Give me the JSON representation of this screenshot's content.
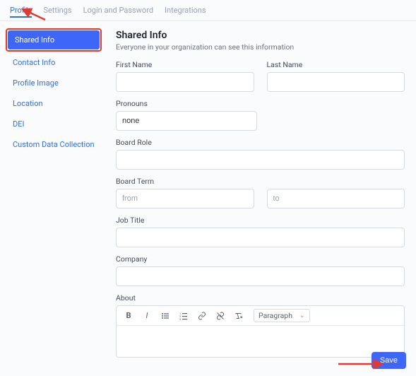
{
  "topTabs": {
    "profile": "Profile",
    "settings": "Settings",
    "login": "Login and Password",
    "integrations": "Integrations"
  },
  "sidebar": {
    "sharedInfo": "Shared Info",
    "contactInfo": "Contact Info",
    "profileImage": "Profile Image",
    "location": "Location",
    "dei": "DEI",
    "customData": "Custom Data Collection"
  },
  "section": {
    "title": "Shared Info",
    "subtitle": "Everyone in your organization can see this information"
  },
  "fields": {
    "firstName": {
      "label": "First Name",
      "value": ""
    },
    "lastName": {
      "label": "Last Name",
      "value": ""
    },
    "pronouns": {
      "label": "Pronouns",
      "value": "none"
    },
    "boardRole": {
      "label": "Board Role",
      "value": ""
    },
    "boardTerm": {
      "label": "Board Term",
      "fromPlaceholder": "from",
      "toPlaceholder": "to"
    },
    "jobTitle": {
      "label": "Job Title",
      "value": ""
    },
    "company": {
      "label": "Company",
      "value": ""
    },
    "about": {
      "label": "About"
    }
  },
  "editor": {
    "formatLabel": "Paragraph"
  },
  "buttons": {
    "save": "Save"
  }
}
